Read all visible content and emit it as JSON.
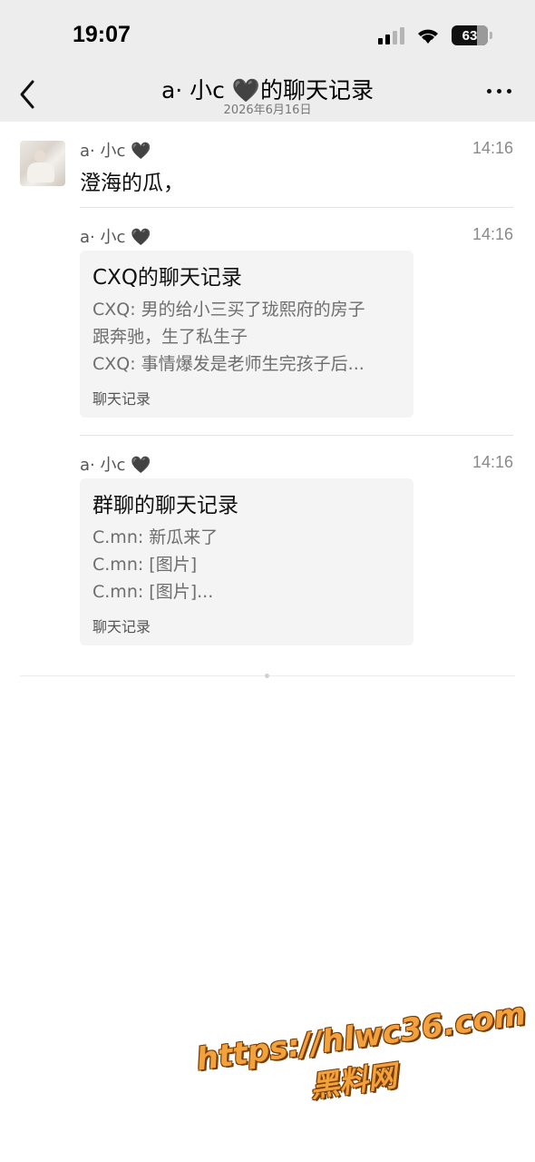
{
  "status_bar": {
    "time": "19:07",
    "battery": "63"
  },
  "nav": {
    "title": "a· 小c 🖤的聊天记录",
    "subtitle": "2026年6月16日"
  },
  "messages": [
    {
      "sender": "a· 小c 🖤",
      "time": "14:16",
      "text": "澄海的瓜，"
    },
    {
      "sender": "a· 小c 🖤",
      "time": "14:16",
      "card": {
        "title": "CXQ的聊天记录",
        "lines": [
          "CXQ: 男的给小三买了珑熙府的房子",
          "跟奔驰，生了私生子",
          "CXQ: 事情爆发是老师生完孩子后..."
        ],
        "footer": "聊天记录"
      }
    },
    {
      "sender": "a· 小c 🖤",
      "time": "14:16",
      "card": {
        "title": "群聊的聊天记录",
        "lines": [
          "C.mn: 新瓜来了",
          "C.mn: [图片]",
          "C.mn: [图片]..."
        ],
        "footer": "聊天记录"
      }
    }
  ],
  "watermark": {
    "url": "https://hlwc36.com",
    "name": "黑料网"
  }
}
